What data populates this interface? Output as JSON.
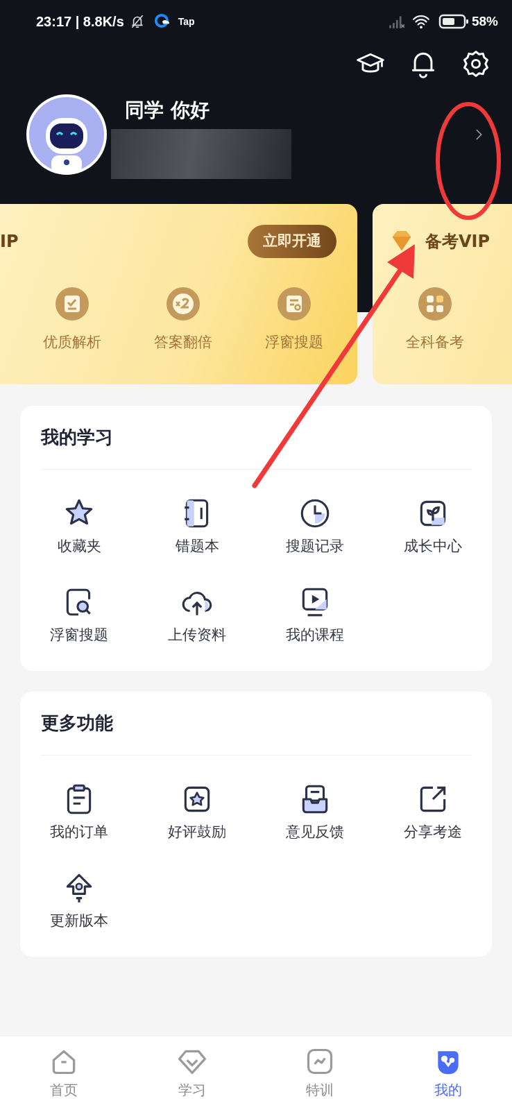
{
  "status_bar": {
    "time": "23:17 | 8.8K/s",
    "app_label": "Tap",
    "battery": "58%"
  },
  "profile": {
    "greeting": "同学 你好"
  },
  "vip_cards": [
    {
      "title": "IP",
      "button": "立即开通",
      "features": [
        "优质解析",
        "答案翻倍",
        "浮窗搜题"
      ]
    },
    {
      "title": "备考VIP",
      "features": [
        "全科备考"
      ]
    }
  ],
  "sections": [
    {
      "title": "我的学习",
      "items": [
        "收藏夹",
        "错题本",
        "搜题记录",
        "成长中心",
        "浮窗搜题",
        "上传资料",
        "我的课程"
      ]
    },
    {
      "title": "更多功能",
      "items": [
        "我的订单",
        "好评鼓励",
        "意见反馈",
        "分享考途",
        "更新版本"
      ]
    }
  ],
  "bottom_nav": [
    {
      "label": "首页",
      "selected": false
    },
    {
      "label": "学习",
      "selected": false
    },
    {
      "label": "特训",
      "selected": false
    },
    {
      "label": "我的",
      "selected": true
    }
  ]
}
